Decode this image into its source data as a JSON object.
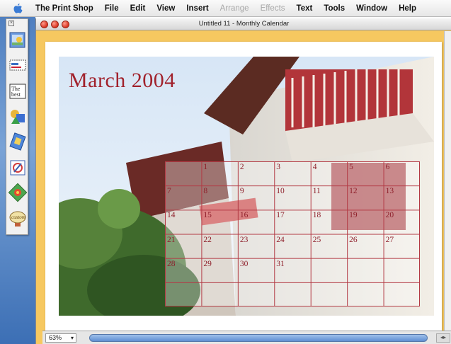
{
  "menubar": {
    "app_name": "The Print Shop",
    "items": [
      "File",
      "Edit",
      "View",
      "Insert",
      "Arrange",
      "Effects",
      "Text",
      "Tools",
      "Window",
      "Help"
    ],
    "disabled_items": [
      "Arrange",
      "Effects"
    ]
  },
  "window": {
    "title": "Untitled 11 - Monthly Calendar"
  },
  "calendar": {
    "title": "March 2004",
    "weeks": [
      [
        "",
        "1",
        "2",
        "3",
        "4",
        "5",
        "6"
      ],
      [
        "7",
        "8",
        "9",
        "10",
        "11",
        "12",
        "13"
      ],
      [
        "14",
        "15",
        "16",
        "17",
        "18",
        "19",
        "20"
      ],
      [
        "21",
        "22",
        "23",
        "24",
        "25",
        "26",
        "27"
      ],
      [
        "28",
        "29",
        "30",
        "31",
        "",
        "",
        ""
      ],
      [
        "",
        "",
        "",
        "",
        "",
        "",
        ""
      ]
    ],
    "text_color": "#8e1f2a",
    "line_color": "#b33a44"
  },
  "status": {
    "zoom": "63%"
  },
  "palette_icons": [
    "photo-tool-icon",
    "stamp-tool-icon",
    "text-tool-icon",
    "shape-tool-icon",
    "image-tool-icon",
    "graphic-tool-icon",
    "clipart-tool-icon",
    "custom-tool-icon"
  ],
  "colors": {
    "window_frame": "#f6c860",
    "desktop": "#4f7fc0"
  }
}
